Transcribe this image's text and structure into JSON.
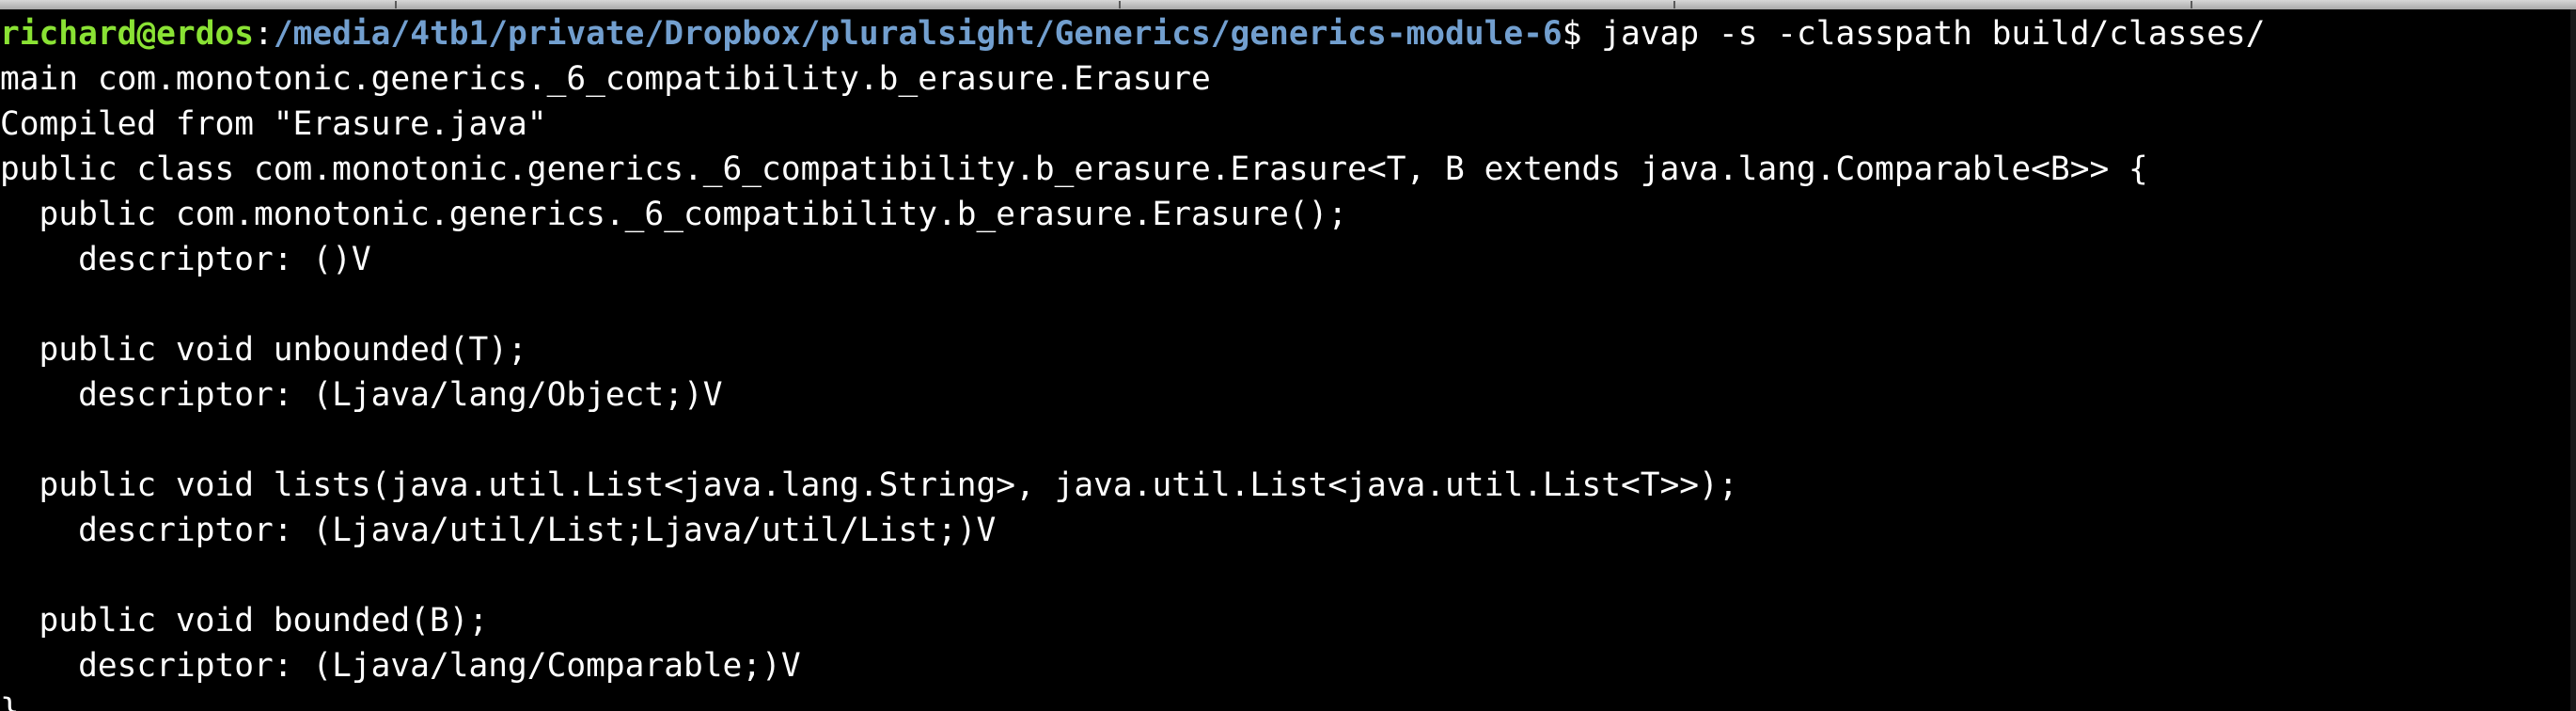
{
  "terminal": {
    "colors": {
      "background": "#000000",
      "text": "#ffffff",
      "prompt_user": "#8ae234",
      "prompt_path": "#729fcf"
    },
    "prompt": {
      "user_host": "richard@erdos",
      "separator": ":",
      "path": "/media/4tb1/private/Dropbox/pluralsight/Generics/generics-module-6",
      "symbol": "$",
      "command": " javap -s -classpath build/classes/"
    },
    "output_lines": [
      "main com.monotonic.generics._6_compatibility.b_erasure.Erasure",
      "Compiled from \"Erasure.java\"",
      "public class com.monotonic.generics._6_compatibility.b_erasure.Erasure<T, B extends java.lang.Comparable<B>> {",
      "  public com.monotonic.generics._6_compatibility.b_erasure.Erasure();",
      "    descriptor: ()V",
      "",
      "  public void unbounded(T);",
      "    descriptor: (Ljava/lang/Object;)V",
      "",
      "  public void lists(java.util.List<java.lang.String>, java.util.List<java.util.List<T>>);",
      "    descriptor: (Ljava/util/List;Ljava/util/List;)V",
      "",
      "  public void bounded(B);",
      "    descriptor: (Ljava/lang/Comparable;)V",
      "}"
    ]
  }
}
